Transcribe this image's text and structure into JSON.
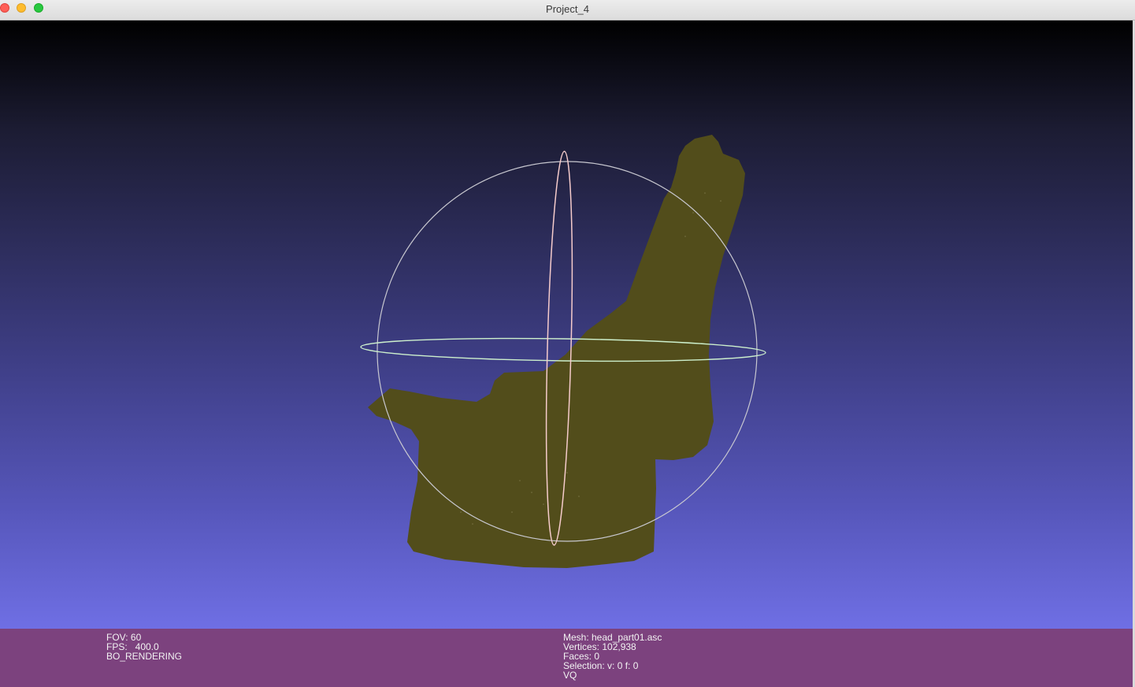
{
  "window": {
    "title": "Project_4"
  },
  "colors": {
    "mesh": "#524d1b",
    "info_bar": "#7c427e",
    "trackball_ring": "#c8c8d0",
    "trackball_vertical": "#f4c6c6",
    "trackball_horizontal": "#c8f0c8"
  },
  "viewport": {
    "trackball": "trackball-gizmo",
    "model": "head_part01 point cloud"
  },
  "info_left": {
    "fov": "FOV: 60",
    "fps": "FPS:   400.0",
    "mode": "BO_RENDERING"
  },
  "info_right": {
    "mesh": "Mesh: head_part01.asc",
    "vertices": "Vertices: 102,938",
    "faces": "Faces: 0",
    "selection": "Selection: v: 0 f: 0",
    "flag": "VQ"
  }
}
